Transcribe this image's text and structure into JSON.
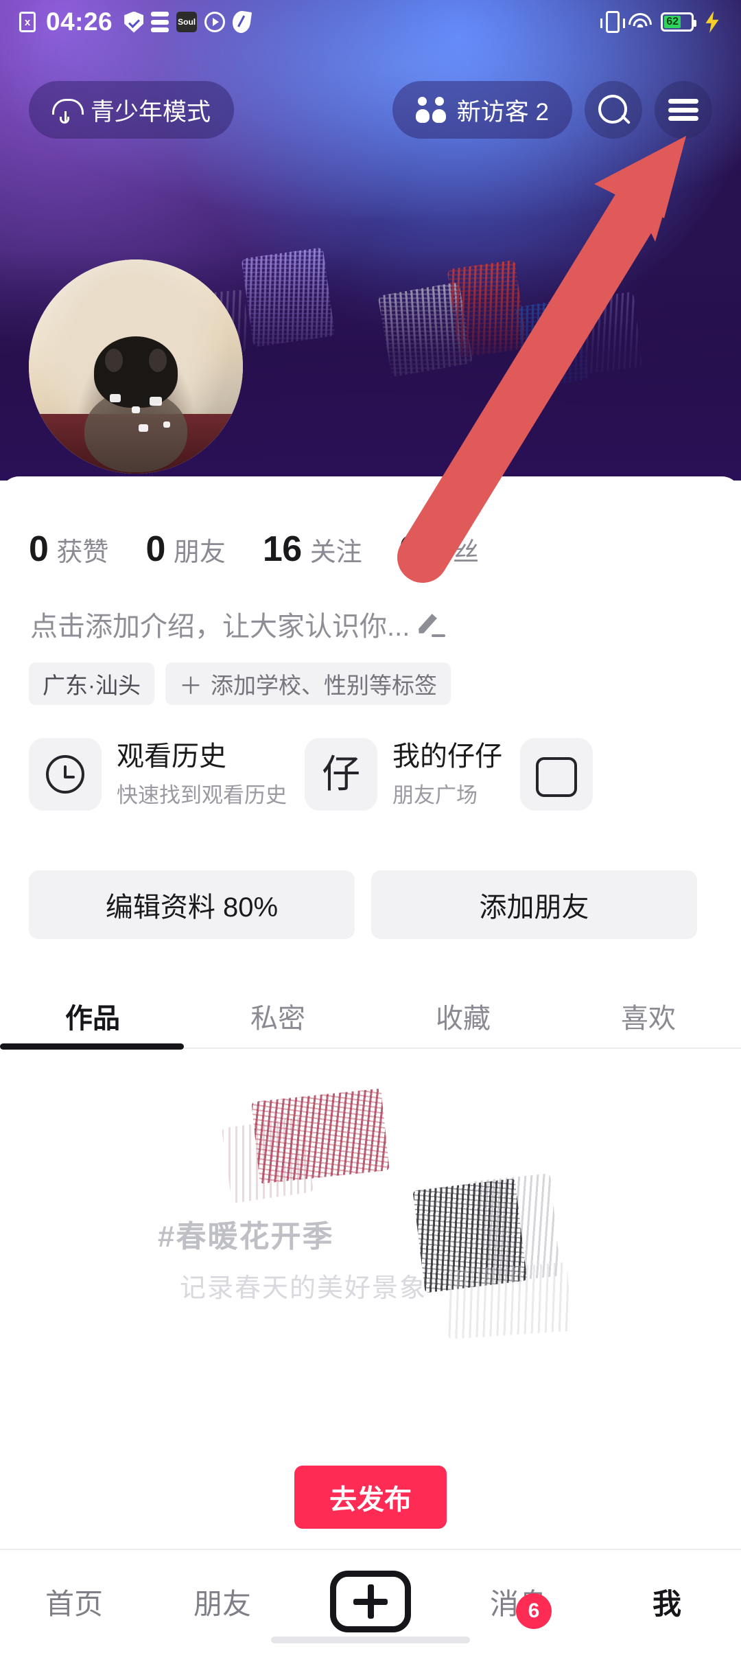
{
  "status_bar": {
    "time": "04:26",
    "battery_level": "62",
    "left_icons": [
      "sim-card-x-icon",
      "shield-check-icon",
      "data-stack-icon",
      "soul-app-icon",
      "play-circle-icon",
      "compass-icon"
    ],
    "right_icons": [
      "vibrate-icon",
      "wifi-icon",
      "battery-icon",
      "charging-bolt-icon"
    ]
  },
  "top_nav": {
    "teen_mode_label": "青少年模式",
    "visitors_label": "新访客 2",
    "search_icon": "search-icon",
    "menu_icon": "hamburger-menu-icon"
  },
  "profile": {
    "avatar": "golden-retriever-puppy-avatar",
    "stats": [
      {
        "value": "0",
        "label": "获赞"
      },
      {
        "value": "0",
        "label": "朋友"
      },
      {
        "value": "16",
        "label": "关注"
      },
      {
        "value": "6",
        "label": "粉丝"
      }
    ],
    "bio_placeholder": "点击添加介绍，让大家认识你...",
    "bio_edit_icon": "pencil-icon",
    "tags": [
      {
        "text": "广东·汕头",
        "has_plus": false
      },
      {
        "text": "添加学校、性别等标签",
        "has_plus": true
      }
    ]
  },
  "quick_cards": [
    {
      "icon": "clock-icon",
      "title": "观看历史",
      "subtitle": "快速找到观看历史"
    },
    {
      "icon": "zai-glyph-icon",
      "glyph": "仔",
      "title": "我的仔仔",
      "subtitle": "朋友广场"
    },
    {
      "icon": "book-icon",
      "title": "",
      "subtitle": ""
    }
  ],
  "actions": [
    {
      "label": "编辑资料 80%"
    },
    {
      "label": "添加朋友"
    }
  ],
  "tabs": [
    {
      "label": "作品",
      "active": true
    },
    {
      "label": "私密",
      "active": false
    },
    {
      "label": "收藏",
      "active": false
    },
    {
      "label": "喜欢",
      "active": false
    }
  ],
  "empty_state": {
    "title": "#春暖花开季",
    "subtitle": "记录春天的美好景象",
    "publish_label": "去发布",
    "publish_color": "#fe2c55"
  },
  "bottom_nav": {
    "items": [
      {
        "label": "首页",
        "active": false,
        "badge": ""
      },
      {
        "label": "朋友",
        "active": false,
        "badge": ""
      },
      {
        "label": "",
        "active": false,
        "badge": "",
        "icon": "plus-create-icon"
      },
      {
        "label": "消息",
        "active": false,
        "badge": "6"
      },
      {
        "label": "我",
        "active": true,
        "badge": ""
      }
    ]
  },
  "annotation": {
    "arrow_color": "#e05a5a",
    "points_to": "hamburger-menu-icon"
  }
}
